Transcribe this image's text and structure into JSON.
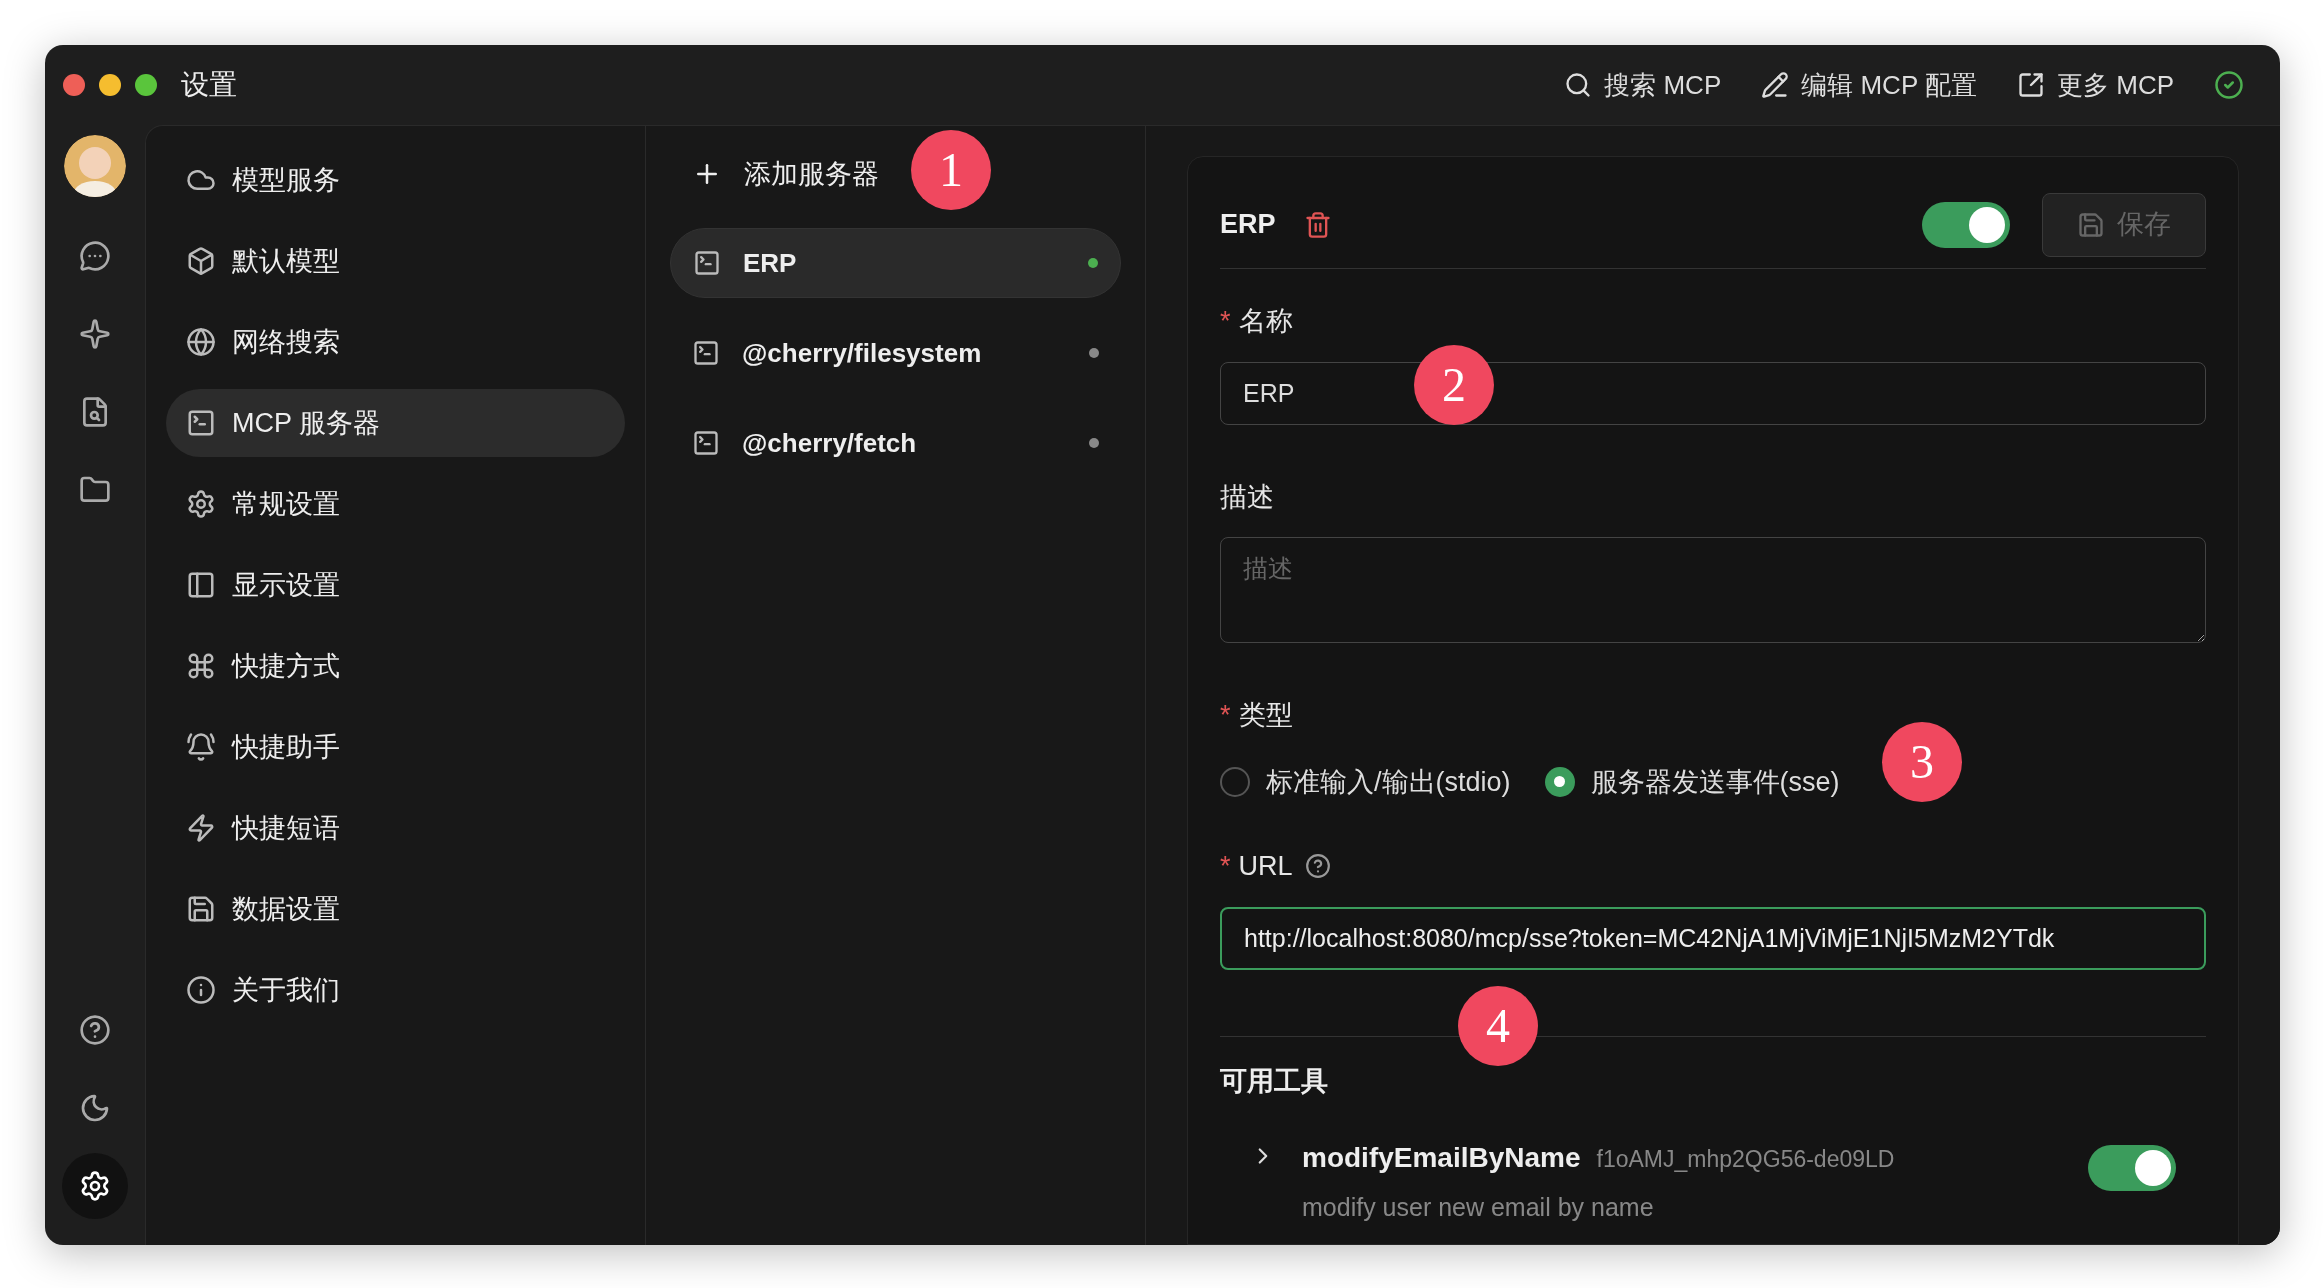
{
  "window": {
    "title": "设置"
  },
  "toolbar": [
    {
      "label": "搜索 MCP"
    },
    {
      "label": "编辑 MCP 配置"
    },
    {
      "label": "更多 MCP"
    }
  ],
  "status": {
    "ok": true
  },
  "nav_rail": [
    {
      "selected": false
    },
    {
      "selected": false
    },
    {
      "selected": false
    },
    {
      "selected": false
    },
    {
      "selected": false
    },
    {
      "selected": false
    },
    {
      "selected": true
    }
  ],
  "settings_menu": [
    {
      "label": "模型服务",
      "selected": false
    },
    {
      "label": "默认模型",
      "selected": false
    },
    {
      "label": "网络搜索",
      "selected": false
    },
    {
      "label": "MCP 服务器",
      "selected": true
    },
    {
      "label": "常规设置",
      "selected": false
    },
    {
      "label": "显示设置",
      "selected": false
    },
    {
      "label": "快捷方式",
      "selected": false
    },
    {
      "label": "快捷助手",
      "selected": false
    },
    {
      "label": "快捷短语",
      "selected": false
    },
    {
      "label": "数据设置",
      "selected": false
    },
    {
      "label": "关于我们",
      "selected": false
    }
  ],
  "servers": {
    "add_label": "添加服务器",
    "items": [
      {
        "name": "ERP",
        "selected": true,
        "active": true
      },
      {
        "name": "@cherry/filesystem",
        "selected": false,
        "active": false
      },
      {
        "name": "@cherry/fetch",
        "selected": false,
        "active": false
      }
    ]
  },
  "detail": {
    "name": "ERP",
    "enabled": true,
    "save_label": "保存",
    "save_disabled": true,
    "name_field": {
      "label": "名称",
      "required_mark": "*",
      "value": "ERP"
    },
    "description_field": {
      "label": "描述",
      "placeholder": "描述"
    },
    "type_field": {
      "label": "类型",
      "required_mark": "*",
      "options": [
        {
          "label": "标准输入/输出(stdio)",
          "selected": false
        },
        {
          "label": "服务器发送事件(sse)",
          "selected": true
        }
      ]
    },
    "url_field": {
      "label": "URL",
      "required_mark": "*",
      "value": "http://localhost:8080/mcp/sse?token=MC42NjA1MjViMjE1NjI5MzM2YTdk"
    },
    "tools_title": "可用工具",
    "tools": [
      {
        "name": "modifyEmailByName",
        "id": "f1oAMJ_mhp2QG56-de09LD",
        "description": "modify user new email by name",
        "enabled": true,
        "expanded": false
      }
    ]
  },
  "annotations": [
    "1",
    "2",
    "3",
    "4"
  ]
}
